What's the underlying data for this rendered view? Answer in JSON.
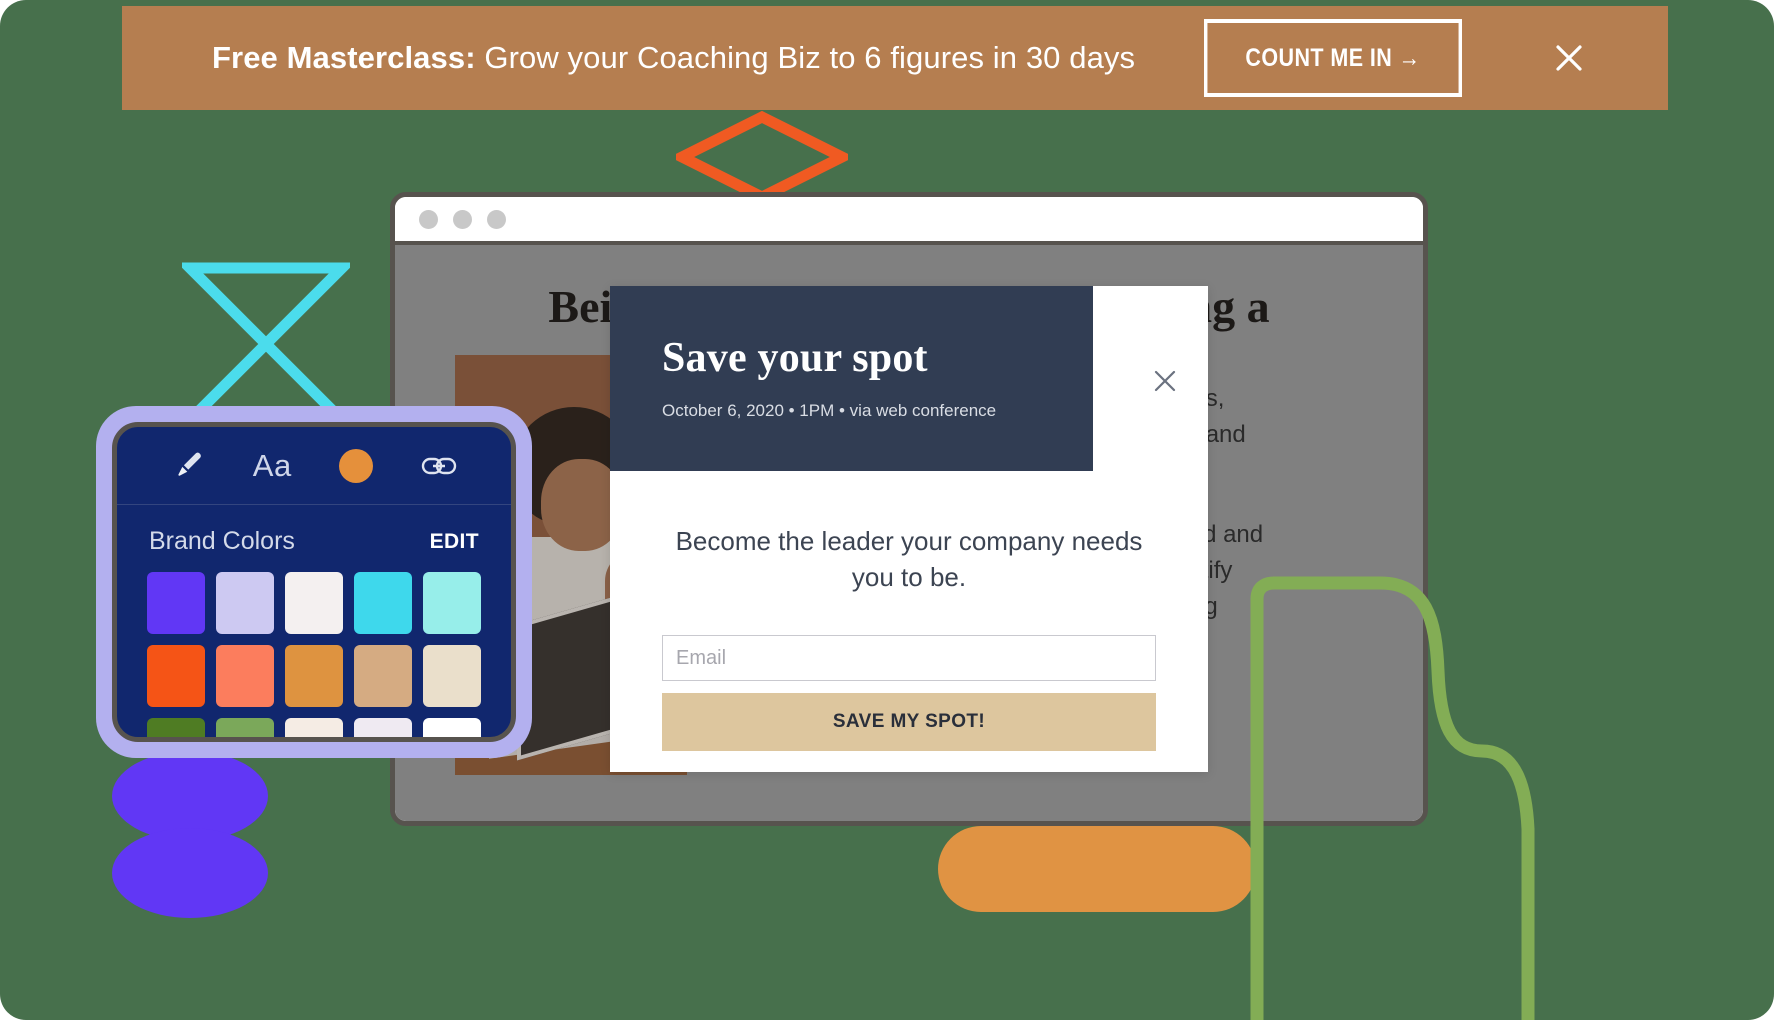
{
  "colors": {
    "green_backdrop": "#47704c",
    "banner_bg": "#b57e50",
    "modal_header": "#313d53",
    "modal_button": "#ddc69e",
    "panel_bg": "#11276e",
    "panel_glow": "#b3b0ef",
    "accent_orange": "#e09343",
    "accent_purple": "#6137f5",
    "accent_cyan": "#4bdcec",
    "accent_orange_outline": "#f05a22",
    "accent_green_line": "#83ad55",
    "window_border": "#57534e"
  },
  "banner": {
    "label_bold": "Free Masterclass:",
    "label_rest": "Grow your Coaching Biz to 6 figures in 30 days",
    "cta_label": "COUNT ME IN →",
    "close_icon": "close-icon"
  },
  "browser": {
    "traffic_lights": [
      "dot-1",
      "dot-2",
      "dot-3"
    ],
    "page": {
      "headline": "Being a good leader isn't just being a boss.",
      "photo_alt": "person-at-laptop-photo",
      "body_paragraphs": [
        "rly reports,\nresults—and\niring the",
        "nlearn old and\nyou identify\nart getting"
      ]
    }
  },
  "modal": {
    "title": "Save your spot",
    "meta": "October 6, 2020 • 1PM • via web conference",
    "lead": "Become the leader your company needs you to be.",
    "email_placeholder": "Email",
    "email_value": "",
    "submit_label": "SAVE MY SPOT!",
    "close_icon": "close-icon"
  },
  "brand_panel": {
    "toolbar": [
      {
        "name": "brush-icon",
        "label": ""
      },
      {
        "name": "text-style-tool",
        "label": "Aa"
      },
      {
        "name": "color-swatch-tool",
        "label": ""
      },
      {
        "name": "link-icon",
        "label": ""
      }
    ],
    "section_title": "Brand Colors",
    "edit_label": "EDIT",
    "swatches": [
      "#6137f5",
      "#cdc9f2",
      "#f4f0f0",
      "#3ed8ec",
      "#97eeea",
      "#f55416",
      "#fc7d5d",
      "#de9340",
      "#d5ab82",
      "#eadfcb",
      "#4f7c23",
      "#7ba85a",
      "#f5ece4",
      "#efeaf2",
      "#ffffff"
    ]
  },
  "decorations": [
    {
      "name": "orange-diamond-outline"
    },
    {
      "name": "cyan-hourglass-outline"
    },
    {
      "name": "purple-blob-pair"
    },
    {
      "name": "orange-pill"
    },
    {
      "name": "green-curve-line"
    }
  ]
}
